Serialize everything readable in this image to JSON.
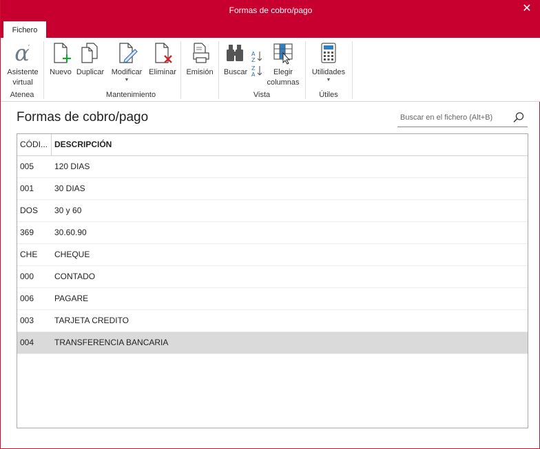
{
  "window": {
    "title": "Formas de cobro/pago",
    "close_glyph": "✕"
  },
  "tabs": [
    {
      "label": "Fichero"
    }
  ],
  "ribbon": {
    "groups": [
      {
        "label": "Atenea",
        "buttons": [
          {
            "label": "Asistente virtual",
            "icon": "alpha-icon"
          }
        ]
      },
      {
        "label": "Mantenimiento",
        "buttons": [
          {
            "label": "Nuevo",
            "icon": "new-document-icon"
          },
          {
            "label": "Duplicar",
            "icon": "duplicate-icon"
          },
          {
            "label": "Modificar",
            "icon": "edit-document-icon",
            "dropdown": true
          },
          {
            "label": "Eliminar",
            "icon": "delete-document-icon"
          },
          {
            "label": "Emisión",
            "icon": "print-icon"
          }
        ]
      },
      {
        "label": "Vista",
        "buttons": [
          {
            "label": "Buscar",
            "icon": "binoculars-icon"
          },
          {
            "label": "",
            "icon": "sort-az-icon"
          },
          {
            "label": "Elegir columnas",
            "icon": "columns-icon"
          }
        ]
      },
      {
        "label": "Útiles",
        "buttons": [
          {
            "label": "Utilidades",
            "icon": "calculator-icon",
            "dropdown": true
          }
        ]
      }
    ],
    "asistente_line1": "Asistente",
    "asistente_line2": "virtual",
    "elegir_line1": "Elegir",
    "elegir_line2": "columnas"
  },
  "main": {
    "title": "Formas de cobro/pago",
    "search": {
      "placeholder": "Buscar en el fichero (Alt+B)",
      "value": ""
    },
    "table": {
      "columns": [
        "CÓDI...",
        "DESCRIPCIÓN"
      ],
      "rows": [
        {
          "code": "005",
          "description": "120 DIAS"
        },
        {
          "code": "001",
          "description": "30 DIAS"
        },
        {
          "code": "DOS",
          "description": "30 y 60"
        },
        {
          "code": "369",
          "description": "30.60.90"
        },
        {
          "code": "CHE",
          "description": "CHEQUE"
        },
        {
          "code": "000",
          "description": "CONTADO"
        },
        {
          "code": "006",
          "description": "PAGARE"
        },
        {
          "code": "003",
          "description": "TARJETA CREDITO"
        },
        {
          "code": "004",
          "description": "TRANSFERENCIA BANCARIA"
        }
      ],
      "selected_index": 8
    }
  },
  "colors": {
    "brand": "#c8002f",
    "selected_row": "#dadada"
  }
}
